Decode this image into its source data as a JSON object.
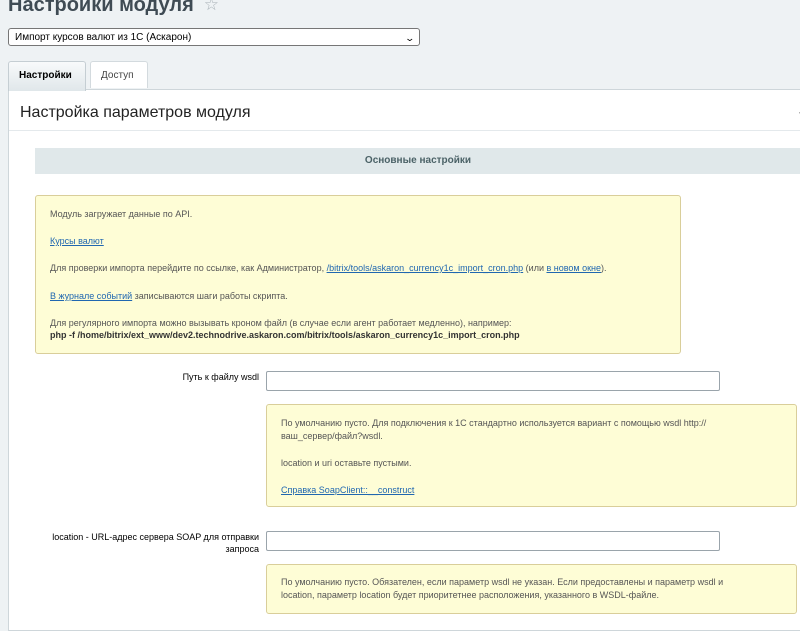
{
  "header": {
    "title": "Настройки модуля"
  },
  "module_select": {
    "selected": "Импорт курсов валют из 1С (Аскарон)"
  },
  "tabs": [
    {
      "label": "Настройки",
      "active": true
    },
    {
      "label": "Доступ",
      "active": false
    }
  ],
  "panel": {
    "title": "Настройка параметров модуля"
  },
  "section": {
    "title": "Основные настройки"
  },
  "info_note": {
    "line1": "Модуль загружает данные по API.",
    "link_rates": "Курсы валют",
    "check_prefix": "Для проверки импорта перейдите по ссылке, как Администратор, ",
    "check_link": "/bitrix/tools/askaron_currency1c_import_cron.php",
    "check_middle": " (или ",
    "check_newwindow": "в новом окне",
    "check_suffix": ").",
    "log_link": "В журнале событий",
    "log_suffix": " записываются шаги работы скрипта.",
    "cron_text": "Для регулярного импорта можно вызывать кроном файл (в случае если агент работает медленно), например:",
    "cron_command": "php -f /home/bitrix/ext_www/dev2.technodrive.askaron.com/bitrix/tools/askaron_currency1c_import_cron.php"
  },
  "wsdl_field": {
    "label": "Путь к файлу wsdl",
    "value": "",
    "hint_line1": "По умолчанию пусто. Для подключения к 1С стандартно используется вариант с помощью wsdl http://",
    "hint_line2": "ваш_сервер/файл?wsdl.",
    "hint_line3": "location и uri оставьте пустыми.",
    "hint_link": "Справка SoapClient::__construct"
  },
  "location_field": {
    "label_line1": "location - URL-адрес сервера SOAP для отправки",
    "label_line2": "запроса",
    "value": "",
    "hint_line1": "По умолчанию пусто. Обязателен, если параметр wsdl не указан. Если предоставлены и параметр wsdl и",
    "hint_line2": "location, параметр location будет приоритетнее расположения, указанного в WSDL-файле."
  },
  "colors": {
    "background": "#eef2f4",
    "note_background": "#fefdd6",
    "link": "#2067b0",
    "section_header": "#e0e8ea"
  }
}
